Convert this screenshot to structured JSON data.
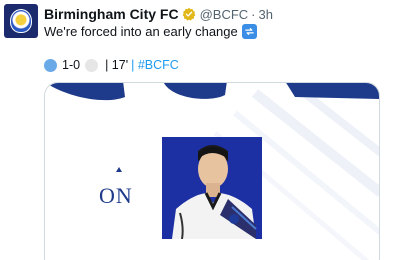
{
  "tweet": {
    "author": "Birmingham City FC",
    "handle": "@BCFC",
    "separator": "·",
    "time": "3h",
    "text": "We're forced into an early change",
    "score": "1-0",
    "minute": "| 17'",
    "hashtag": "| #BCFC"
  },
  "card": {
    "on_label": "ON"
  },
  "icons": {
    "verified": "verified-badge-icon",
    "swap": "substitution-arrows-icon",
    "home_ball": "blue-circle-icon",
    "away_ball": "white-circle-icon"
  },
  "colors": {
    "brand_navy": "#1e3a8a",
    "photo_bg": "#1c2fa3",
    "hashtag": "#1d9bf0",
    "muted_text": "#536471",
    "verified_gold": "#e2b719"
  }
}
